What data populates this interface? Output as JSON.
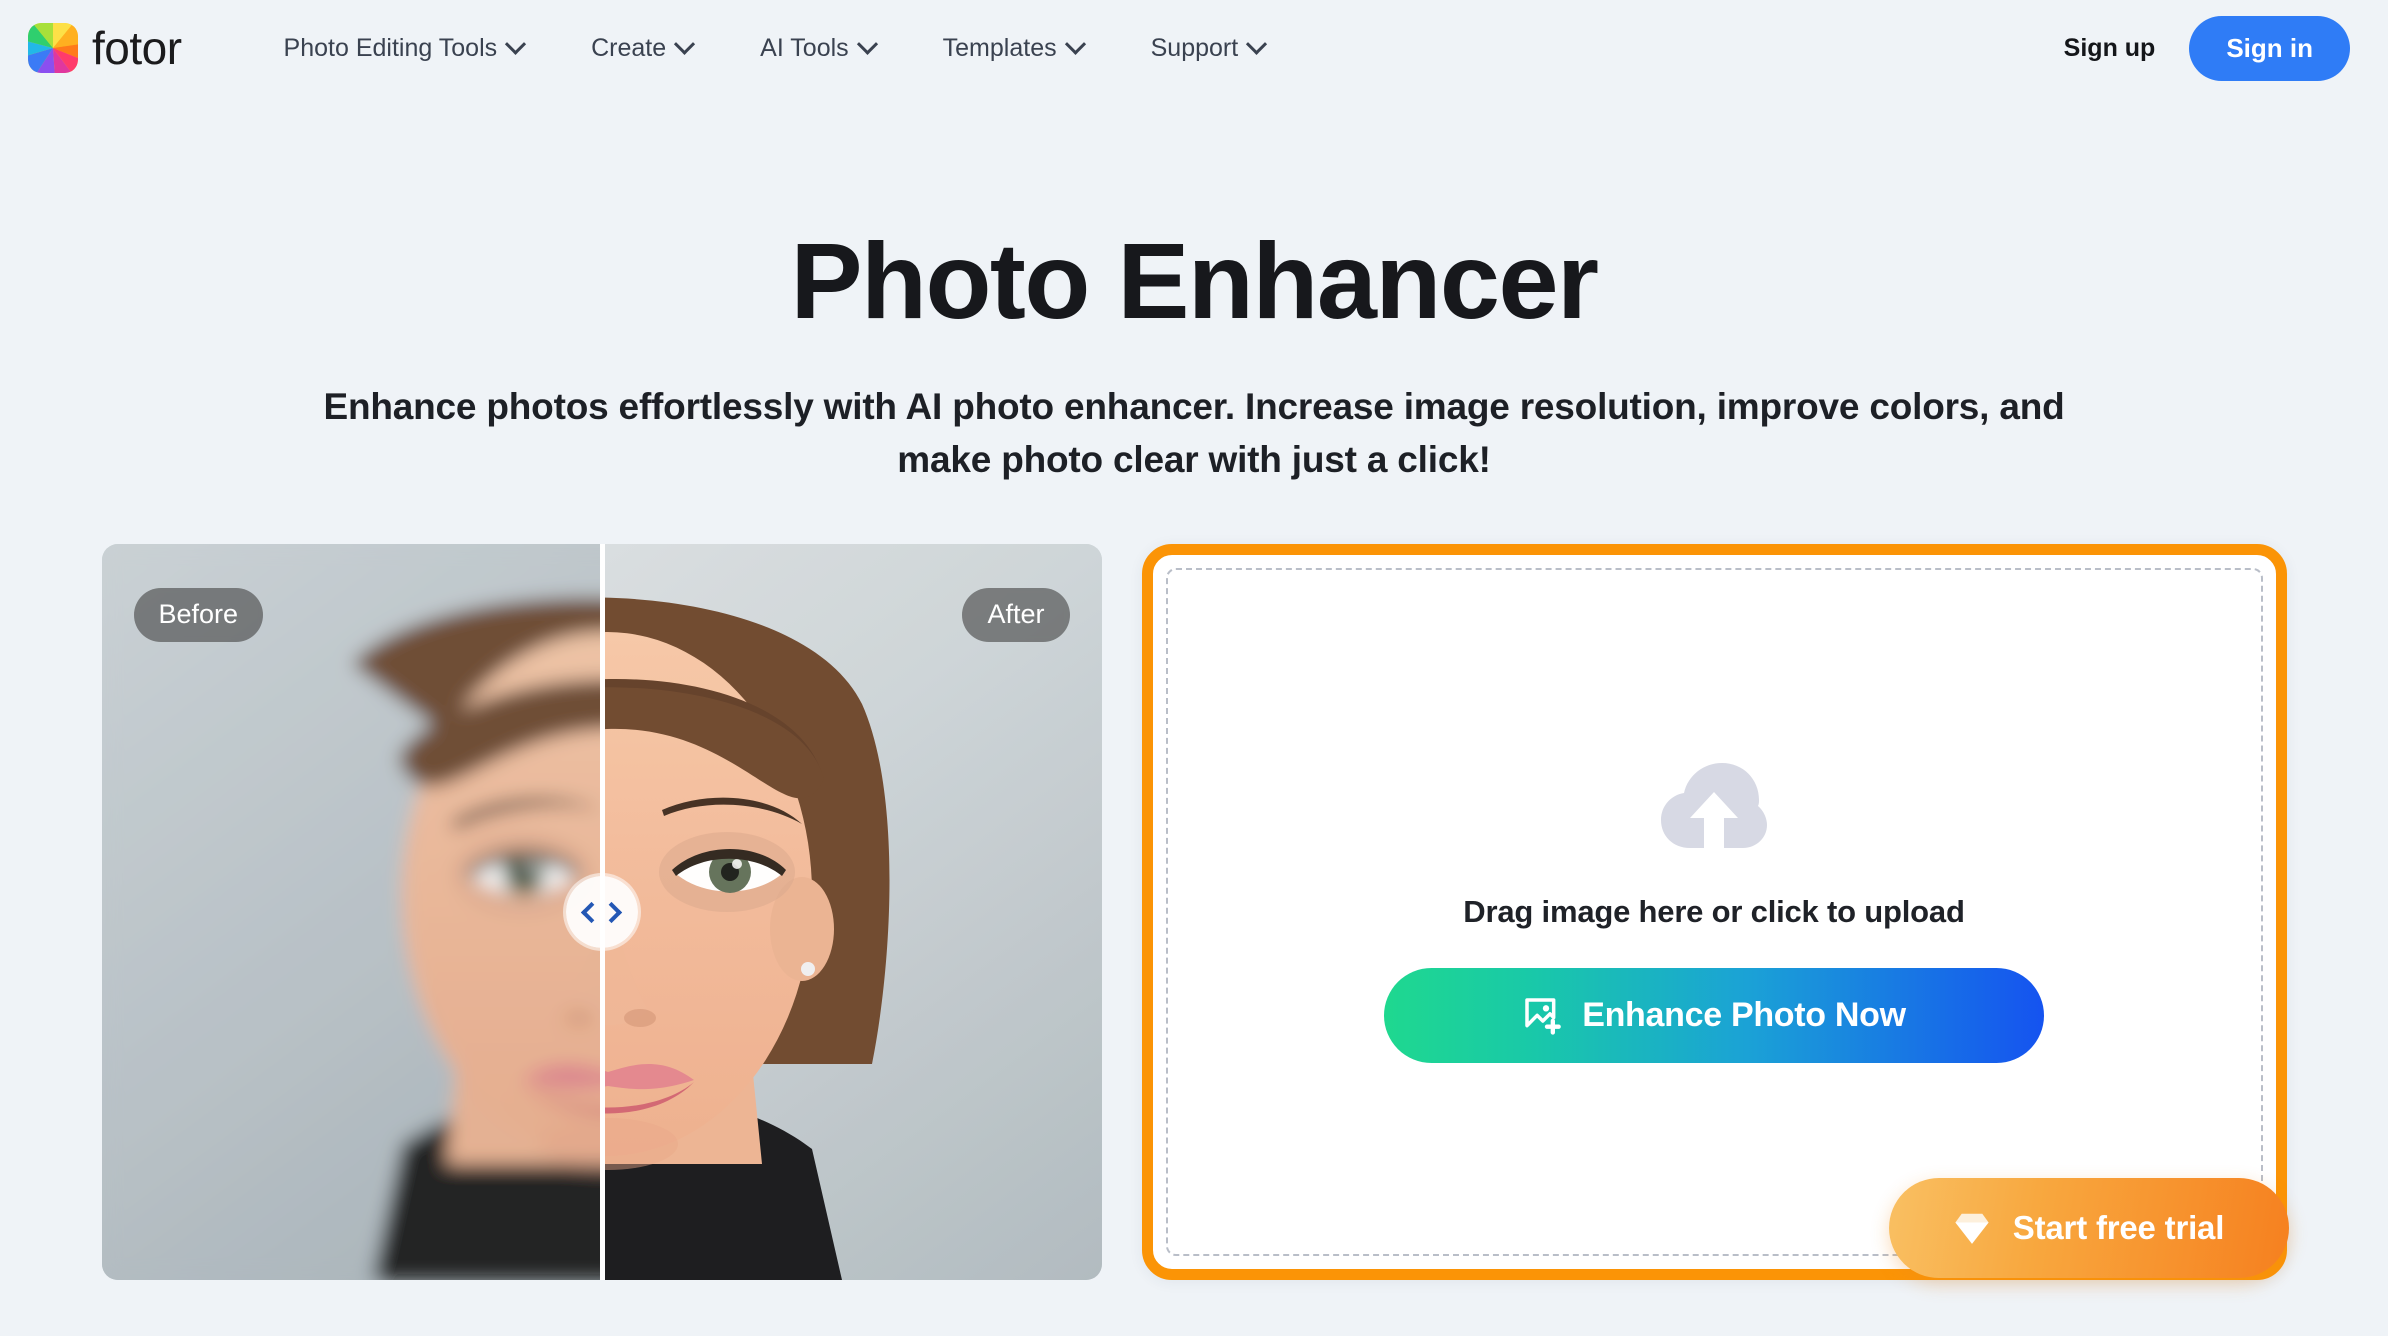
{
  "brand": {
    "name": "fotor",
    "logo_icon": "color-wheel-logo-icon"
  },
  "nav": {
    "items": [
      {
        "label": "Photo Editing Tools",
        "has_dropdown": true
      },
      {
        "label": "Create",
        "has_dropdown": true
      },
      {
        "label": "AI Tools",
        "has_dropdown": true
      },
      {
        "label": "Templates",
        "has_dropdown": true
      },
      {
        "label": "Support",
        "has_dropdown": true
      }
    ],
    "dropdown_icon": "chevron-down-icon"
  },
  "account": {
    "sign_up_label": "Sign up",
    "sign_in_label": "Sign in",
    "sign_in_color": "#2f7cf6"
  },
  "hero": {
    "title": "Photo Enhancer",
    "subtitle": "Enhance photos effortlessly with AI photo enhancer. Increase image resolution, improve colors, and make photo clear with just a click!"
  },
  "comparison": {
    "before_label": "Before",
    "after_label": "After",
    "slider_position_percent": 50,
    "handle_icon": "left-right-chevrons-icon",
    "handle_arrow_color": "#2457b4",
    "image_description": "Close-up portrait of a young woman in a black turtleneck; left half blurred, right half sharp"
  },
  "upload": {
    "border_color": "#fb9406",
    "cloud_icon": "cloud-upload-icon",
    "drag_text": "Drag image here or click to upload",
    "enhance_button": {
      "label": "Enhance Photo Now",
      "icon": "add-image-icon",
      "gradient_from": "#1fd88f",
      "gradient_to": "#1553f0"
    },
    "trial_button": {
      "label": "Start free trial",
      "icon": "diamond-gem-icon",
      "gradient_from": "#f9c063",
      "gradient_to": "#f6801f"
    }
  },
  "page": {
    "background_color": "#eff3f7"
  }
}
